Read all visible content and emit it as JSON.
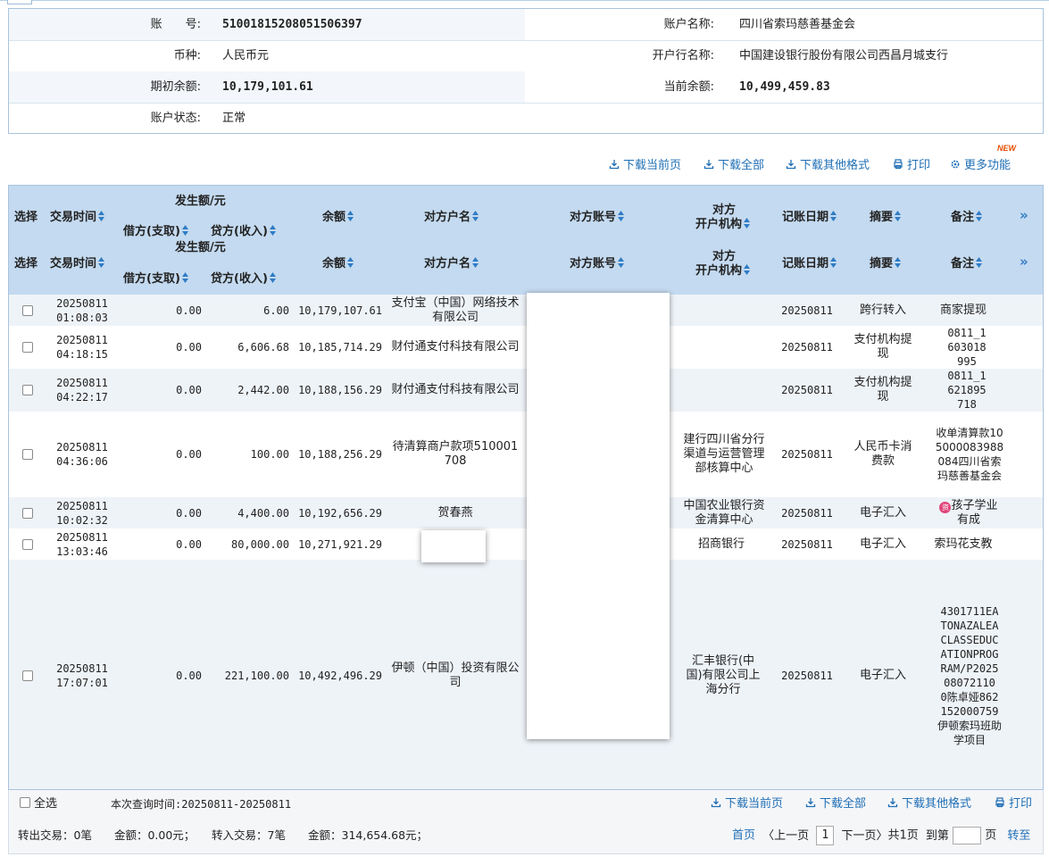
{
  "account": {
    "number_label": "账　　号:",
    "number": "51001815208051506397",
    "name_label": "账户名称:",
    "name": "四川省索玛慈善基金会",
    "currency_label": "币种:",
    "currency": "人民币元",
    "bank_label": "开户行名称:",
    "bank": "中国建设银行股份有限公司西昌月城支行",
    "opening_balance_label": "期初余额:",
    "opening_balance": "10,179,101.61",
    "current_balance_label": "当前余额:",
    "current_balance": "10,499,459.83",
    "status_label": "账户状态:",
    "status": "正常"
  },
  "toolbar": {
    "download_page": "下载当前页",
    "download_all": "下载全部",
    "download_other": "下载其他格式",
    "print": "打印",
    "more": "更多功能",
    "new_badge": "NEW"
  },
  "table": {
    "headers": {
      "select": "选择",
      "time": "交易时间",
      "amount_group": "发生额/元",
      "debit": "借方(支取)",
      "credit": "贷方(收入)",
      "balance": "余额",
      "party_name": "对方户名",
      "party_account": "对方账号",
      "party_bank_1": "对方",
      "party_bank_2": "开户机构",
      "post_date": "记账日期",
      "summary": "摘要",
      "remark": "备注",
      "more": "»"
    },
    "rows": [
      {
        "date": "20250811",
        "time": "01:08:03",
        "debit": "0.00",
        "credit": "6.00",
        "balance": "10,179,107.61",
        "party": "支付宝（中国）网络技术有限公司",
        "bank": "",
        "post_date": "20250811",
        "summary": "跨行转入",
        "remark": "商家提现"
      },
      {
        "date": "20250811",
        "time": "04:18:15",
        "debit": "0.00",
        "credit": "6,606.68",
        "balance": "10,185,714.29",
        "party": "财付通支付科技有限公司",
        "bank": "",
        "post_date": "20250811",
        "summary": "支付机构提现",
        "remark": "0811_1603018995"
      },
      {
        "date": "20250811",
        "time": "04:22:17",
        "debit": "0.00",
        "credit": "2,442.00",
        "balance": "10,188,156.29",
        "party": "财付通支付科技有限公司",
        "bank": "",
        "post_date": "20250811",
        "summary": "支付机构提现",
        "remark": "0811_1621895718"
      },
      {
        "date": "20250811",
        "time": "04:36:06",
        "debit": "0.00",
        "credit": "100.00",
        "balance": "10,188,256.29",
        "party": "待清算商户款项510001708",
        "bank": "建行四川省分行渠道与运营管理部核算中心",
        "post_date": "20250811",
        "summary": "人民币卡消费款",
        "remark": "收单清算款105000083988084四川省索玛慈善基金会"
      },
      {
        "date": "20250811",
        "time": "10:02:32",
        "debit": "0.00",
        "credit": "4,400.00",
        "balance": "10,192,656.29",
        "party": "贺春燕",
        "bank": "中国农业银行资金清算中心",
        "post_date": "20250811",
        "summary": "电子汇入",
        "remark": "孩子学业有成",
        "remark_icon": "资"
      },
      {
        "date": "20250811",
        "time": "13:03:46",
        "debit": "0.00",
        "credit": "80,000.00",
        "balance": "10,271,921.29",
        "party": "",
        "bank": "招商银行",
        "post_date": "20250811",
        "summary": "电子汇入",
        "remark": "索玛花支教"
      },
      {
        "date": "20250811",
        "time": "17:07:01",
        "debit": "0.00",
        "credit": "221,100.00",
        "balance": "10,492,496.29",
        "party": "伊顿（中国）投资有限公司",
        "bank": "汇丰银行(中国)有限公司上海分行",
        "post_date": "20250811",
        "summary": "电子汇入",
        "remark": "4301711EATONAZALEACLASSEDUCATIONPROGRAM/P202508072110 0陈卓娅862152000759伊顿索玛班助学项目"
      }
    ]
  },
  "footer": {
    "select_all": "全选",
    "query_time": "本次查询时间:20250811-20250811",
    "download_page": "下载当前页",
    "download_all": "下载全部",
    "download_other": "下载其他格式",
    "print": "打印",
    "summary": "转出交易：0笔　　金额：0.00元；　　转入交易：7笔　　金额：314,654.68元；",
    "first": "首页",
    "prev": "〈上一页",
    "page": "1",
    "next": "下一页〉",
    "total": "共1页",
    "goto": "到第",
    "page_unit": "页",
    "go": "转至"
  }
}
